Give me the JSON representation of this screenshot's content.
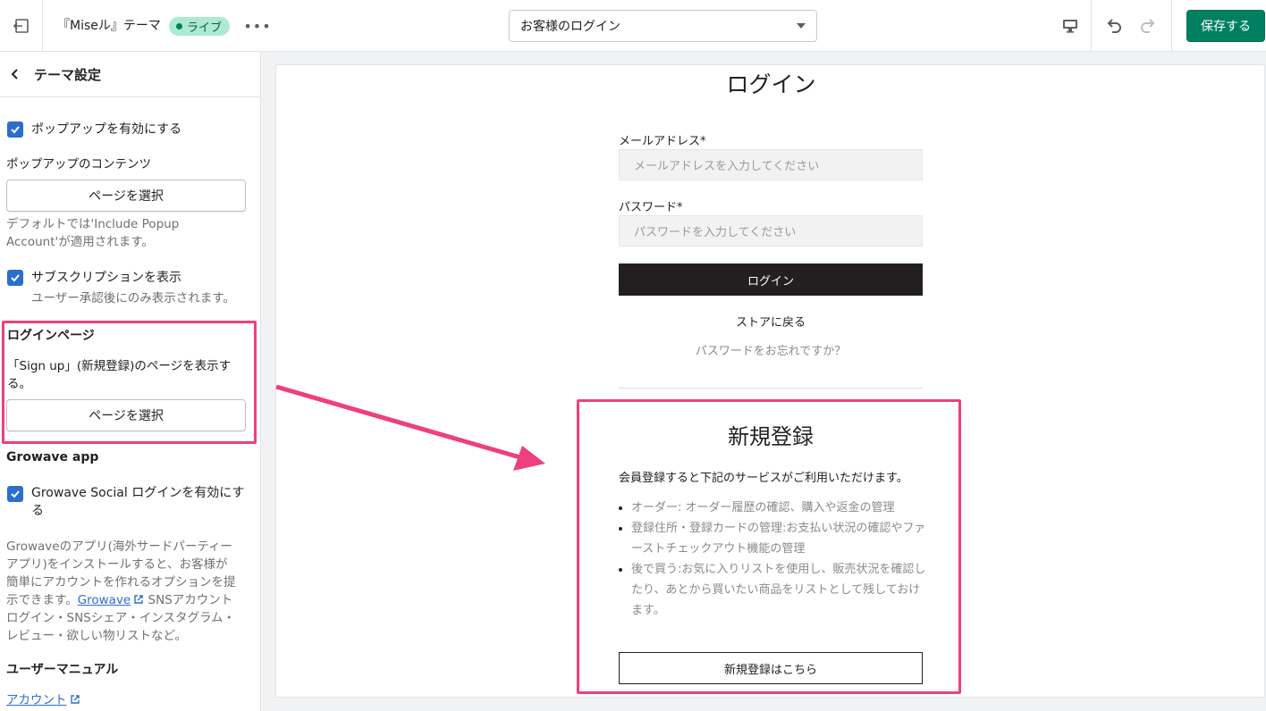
{
  "topbar": {
    "theme_name": "『Miseル』テーマ",
    "live_badge": "ライブ",
    "more_label": "•••",
    "template_select": "お客様のログイン",
    "save_label": "保存する"
  },
  "sidebar": {
    "title": "テーマ設定",
    "popup_enable_label": "ポップアップを有効にする",
    "popup_content_heading": "ポップアップのコンテンツ",
    "select_page_label": "ページを選択",
    "popup_help_line1": "デフォルトでは'Include Popup",
    "popup_help_line2": "Account'が適用されます。",
    "subscription_label": "サブスクリプションを表示",
    "subscription_help": "ユーザー承認後にのみ表示されます。",
    "login_page_heading": "ログインページ",
    "signup_desc_line1": "「Sign up」(新規登録)のページを表示す",
    "signup_desc_line2": "る。",
    "select_page_label_2": "ページを選択",
    "growave_heading": "Growave app",
    "growave_enable_line1": "Growave Social ログインを有効にす",
    "growave_enable_line2": "る",
    "growave_desc_line1": "Growaveのアプリ(海外サードパーティー",
    "growave_desc_line2": "アプリ)をインストールすると、お客様が",
    "growave_desc_line3": "簡単にアカウントを作れるオプションを提",
    "growave_desc_line4_pre": "示できます。",
    "growave_link": "Growave",
    "growave_desc_line4_post": " SNSアカウント",
    "growave_desc_line5": "ログイン・SNSシェア・インスタグラム・",
    "growave_desc_line6": "レビュー・欲しい物リストなど。",
    "manual_heading": "ユーザーマニュアル",
    "account_link": "アカウント"
  },
  "preview": {
    "login_title": "ログイン",
    "email_label": "メールアドレス*",
    "email_placeholder": "メールアドレスを入力してください",
    "password_label": "パスワード*",
    "password_placeholder": "パスワードを入力してください",
    "login_button": "ログイン",
    "back_to_store": "ストアに戻る",
    "forgot_password": "パスワードをお忘れですか？",
    "signup_title": "新規登録",
    "signup_intro": "会員登録すると下記のサービスがご利用いただけます。",
    "benefits": [
      "オーダー: オーダー履歴の確認、購入や返金の管理",
      "登録住所・登録カードの管理:お支払い状況の確認やファーストチェックアウト機能の管理",
      "後で買う:お気に入りリストを使用し、販売状況を確認したり、あとから買いたい商品をリストとして残しておけます。"
    ],
    "signup_button": "新規登録はこちら"
  },
  "colors": {
    "accent": "#008060",
    "highlight": "#ee3f80",
    "checkbox": "#2c6ecb",
    "dark_button": "#231f20"
  }
}
